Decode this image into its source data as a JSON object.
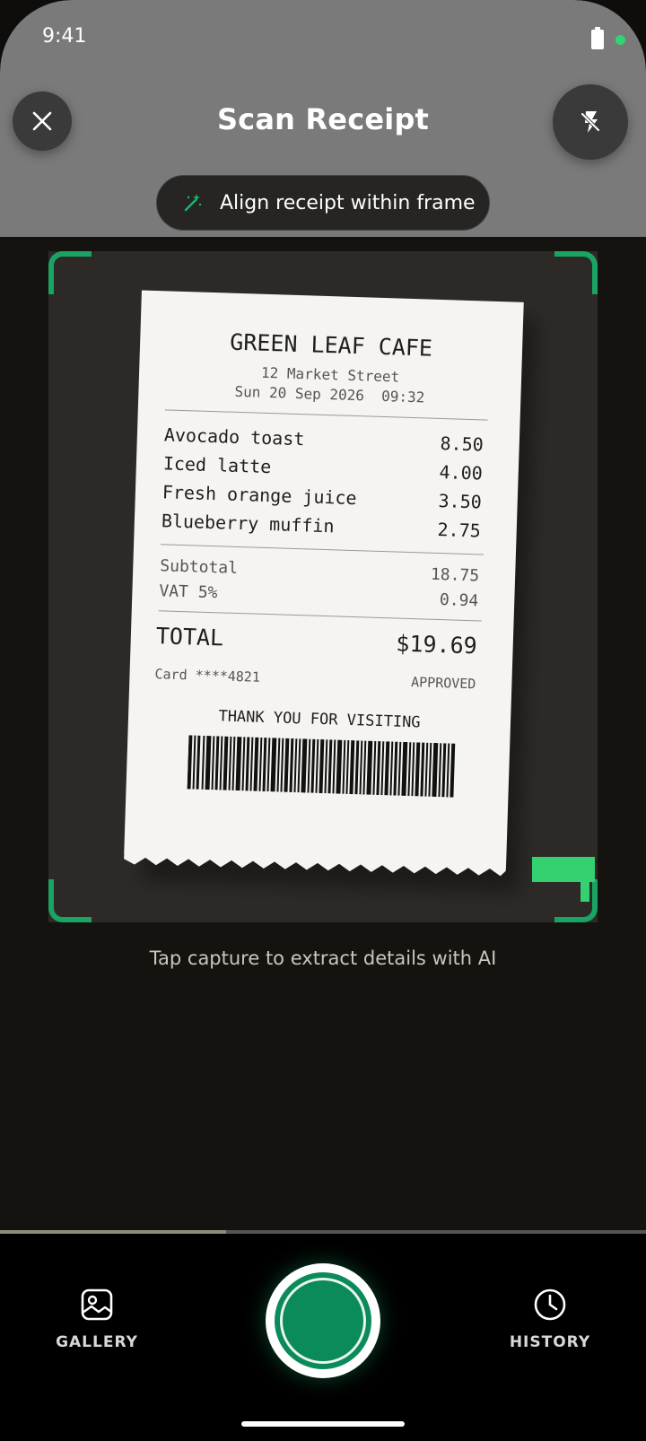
{
  "status": {
    "time": "9:41"
  },
  "header": {
    "title": "Scan Receipt",
    "hint": "Align receipt within frame"
  },
  "receipt": {
    "name": "GREEN LEAF CAFE",
    "address": "12 Market Street",
    "datetime": "Sun 20 Sep 2026  09:32",
    "items": [
      {
        "name": "Avocado toast",
        "price": "8.50"
      },
      {
        "name": "Iced latte",
        "price": "4.00"
      },
      {
        "name": "Fresh orange juice",
        "price": "3.50"
      },
      {
        "name": "Blueberry muffin",
        "price": "2.75"
      }
    ],
    "subtotal_label": "Subtotal",
    "subtotal": "18.75",
    "vat_label": "VAT 5%",
    "vat": "0.94",
    "total_label": "TOTAL",
    "total": "$19.69",
    "card": "Card ****4821",
    "card_status": "APPROVED",
    "thanks": "THANK YOU FOR VISITING"
  },
  "tap_hint": "Tap capture to extract details with AI",
  "progress": 0.35,
  "bottom_nav": {
    "gallery_label": "GALLERY",
    "history_label": "HISTORY"
  },
  "colors": {
    "accent": "#0b8a5a",
    "frame": "#1aa463",
    "status_dot": "#2ed573"
  },
  "icons": {
    "close": "close-icon",
    "flash": "flash-off-icon",
    "hint": "magic-wand-icon",
    "gallery": "image-icon",
    "history": "clock-icon"
  }
}
